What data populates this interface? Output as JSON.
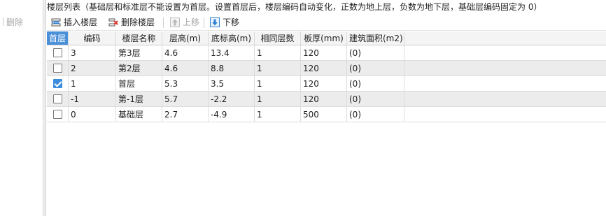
{
  "left_panel": {
    "delete_label": "删除"
  },
  "title": "楼层列表（基础层和标准层不能设置为首层。设置首层后，楼层编码自动变化，正数为地上层，负数为地下层，基础层编码固定为 0）",
  "toolbar": {
    "insert_label": "插入楼层",
    "delete_label": "删除楼层",
    "move_up_label": "上移",
    "move_down_label": "下移"
  },
  "table": {
    "headers": [
      "首层",
      "编码",
      "楼层名称",
      "层高(m)",
      "底标高(m)",
      "相同层数",
      "板厚(mm)",
      "建筑面积(m2)"
    ],
    "rows": [
      {
        "first": false,
        "code": "3",
        "name": "第3层",
        "height": "4.6",
        "bottom": "13.4",
        "same": "1",
        "thickness": "120",
        "area": "(0)"
      },
      {
        "first": false,
        "code": "2",
        "name": "第2层",
        "height": "4.6",
        "bottom": "8.8",
        "same": "1",
        "thickness": "120",
        "area": "(0)"
      },
      {
        "first": true,
        "code": "1",
        "name": "首层",
        "height": "5.3",
        "bottom": "3.5",
        "same": "1",
        "thickness": "120",
        "area": "(0)"
      },
      {
        "first": false,
        "code": "-1",
        "name": "第-1层",
        "height": "5.7",
        "bottom": "-2.2",
        "same": "1",
        "thickness": "120",
        "area": "(0)"
      },
      {
        "first": false,
        "code": "0",
        "name": "基础层",
        "height": "2.7",
        "bottom": "-4.9",
        "same": "1",
        "thickness": "500",
        "area": "(0)"
      }
    ]
  },
  "icons": {
    "insert": "insert-floor-icon",
    "delete": "delete-floor-icon",
    "move_up": "arrow-up-icon",
    "move_down": "arrow-down-icon"
  },
  "colors": {
    "first_header_bg": "#4a90d9",
    "checkbox_checked": "#3c8de0",
    "row_alt": "#ececec",
    "delete_icon_red": "#d9352b",
    "arrow_blue": "#2f7fd3"
  }
}
